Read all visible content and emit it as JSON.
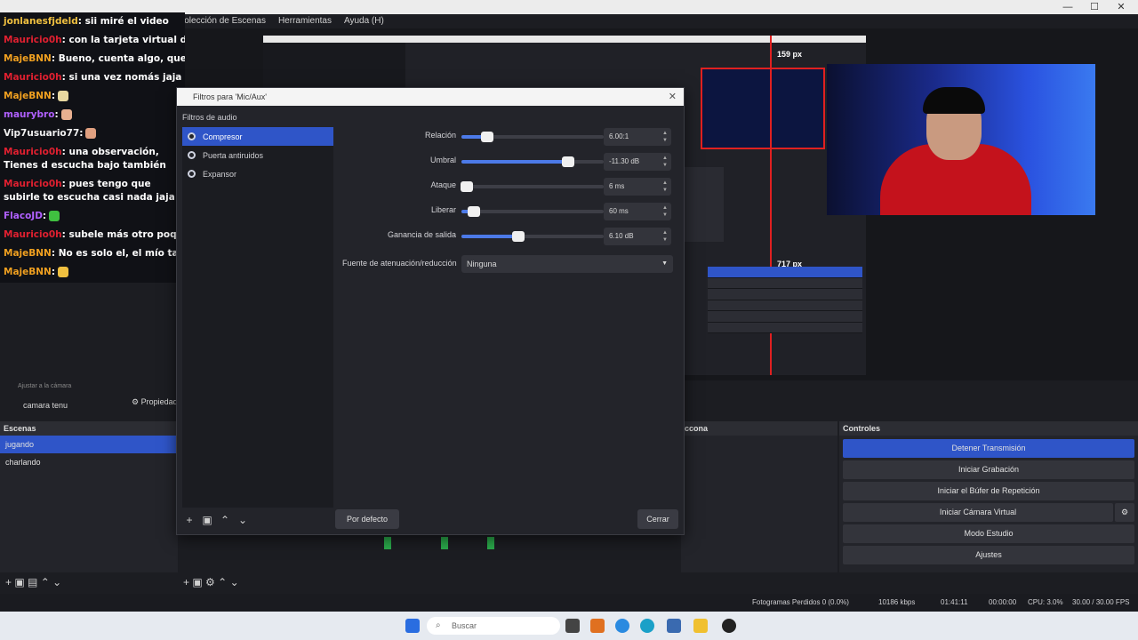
{
  "menu": [
    "Colección de Escenas",
    "Herramientas",
    "Ayuda (H)"
  ],
  "chat": [
    {
      "user": "jonlanesfjdeld",
      "color": "#f0c040",
      "text": ": sii miré el video"
    },
    {
      "user": "Mauricio0h",
      "color": "#e02030",
      "text": ": con la tarjeta virtual de m"
    },
    {
      "user": "MajeBNN",
      "color": "#f0a020",
      "text": ": Bueno, cuenta algo, que tal"
    },
    {
      "user": "Mauricio0h",
      "color": "#e02030",
      "text": ": si una vez nomás jaja o ta"
    },
    {
      "user": "MajeBNN",
      "color": "#f0a020",
      "text": ":",
      "emote": "#e8d8a0"
    },
    {
      "user": "maurybro",
      "color": "#b060ff",
      "text": ":",
      "emote": "#e8b090"
    },
    {
      "user": "Vip7usuario77",
      "color": "#f0f0f0",
      "text": ":",
      "emote": "#e0a080"
    },
    {
      "user": "Mauricio0h",
      "color": "#e02030",
      "text": ": una observación, Tienes d escucha bajo también"
    },
    {
      "user": "Mauricio0h",
      "color": "#e02030",
      "text": ": pues tengo que subirle to escucha casi nada jaja"
    },
    {
      "user": "FlacoJD",
      "color": "#b060ff",
      "text": ":",
      "emote": "#40c040"
    },
    {
      "user": "Mauricio0h",
      "color": "#e02030",
      "text": ": subele más otro poquito a"
    },
    {
      "user": "MajeBNN",
      "color": "#f0a020",
      "text": ": No es solo el, el mío tambié"
    },
    {
      "user": "MajeBNN",
      "color": "#f0a020",
      "text": ":",
      "emote": "#f0c040"
    }
  ],
  "preview": {
    "ps_label_1": "159 px",
    "ps_label_2": "717 px"
  },
  "dialog": {
    "title": "Filtros para 'Mic/Aux'",
    "section_label": "Filtros de audio",
    "filters": [
      "Compresor",
      "Puerta antiruidos",
      "Expansor"
    ],
    "params": [
      {
        "label": "Relación",
        "value": "6.00:1",
        "fill": 0.18
      },
      {
        "label": "Umbral",
        "value": "-11.30 dB",
        "fill": 0.75
      },
      {
        "label": "Ataque",
        "value": "6 ms",
        "fill": 0.04
      },
      {
        "label": "Liberar",
        "value": "60 ms",
        "fill": 0.09
      },
      {
        "label": "Ganancia de salida",
        "value": "6.10 dB",
        "fill": 0.4
      }
    ],
    "sidechain_label": "Fuente de atenuación/reducción",
    "sidechain_value": "Ninguna",
    "defaults_button": "Por defecto",
    "close_button": "Cerrar"
  },
  "sources": {
    "toolbar_label": "Ajustar a la cámara",
    "selected_source": "camara tenu",
    "props_button": "Propiedades"
  },
  "scenes": {
    "title": "Escenas",
    "items": [
      "jugando",
      "charlando"
    ],
    "selected": 0
  },
  "audio_panel_title": "ccona",
  "controls": {
    "title": "Controles",
    "buttons": [
      "Detener Transmisión",
      "Iniciar Grabación",
      "Iniciar el Búfer de Repetición",
      "Iniciar Cámara Virtual",
      "Modo Estudio",
      "Ajustes"
    ]
  },
  "status": {
    "dropped": "Fotogramas Perdidos 0 (0.0%)",
    "bitrate": "10186 kbps",
    "time": "01:41:11",
    "rec": "00:00:00",
    "cpu": "CPU: 3.0%",
    "fps": "30.00 / 30.00 FPS"
  },
  "taskbar": {
    "search_placeholder": "Buscar"
  }
}
